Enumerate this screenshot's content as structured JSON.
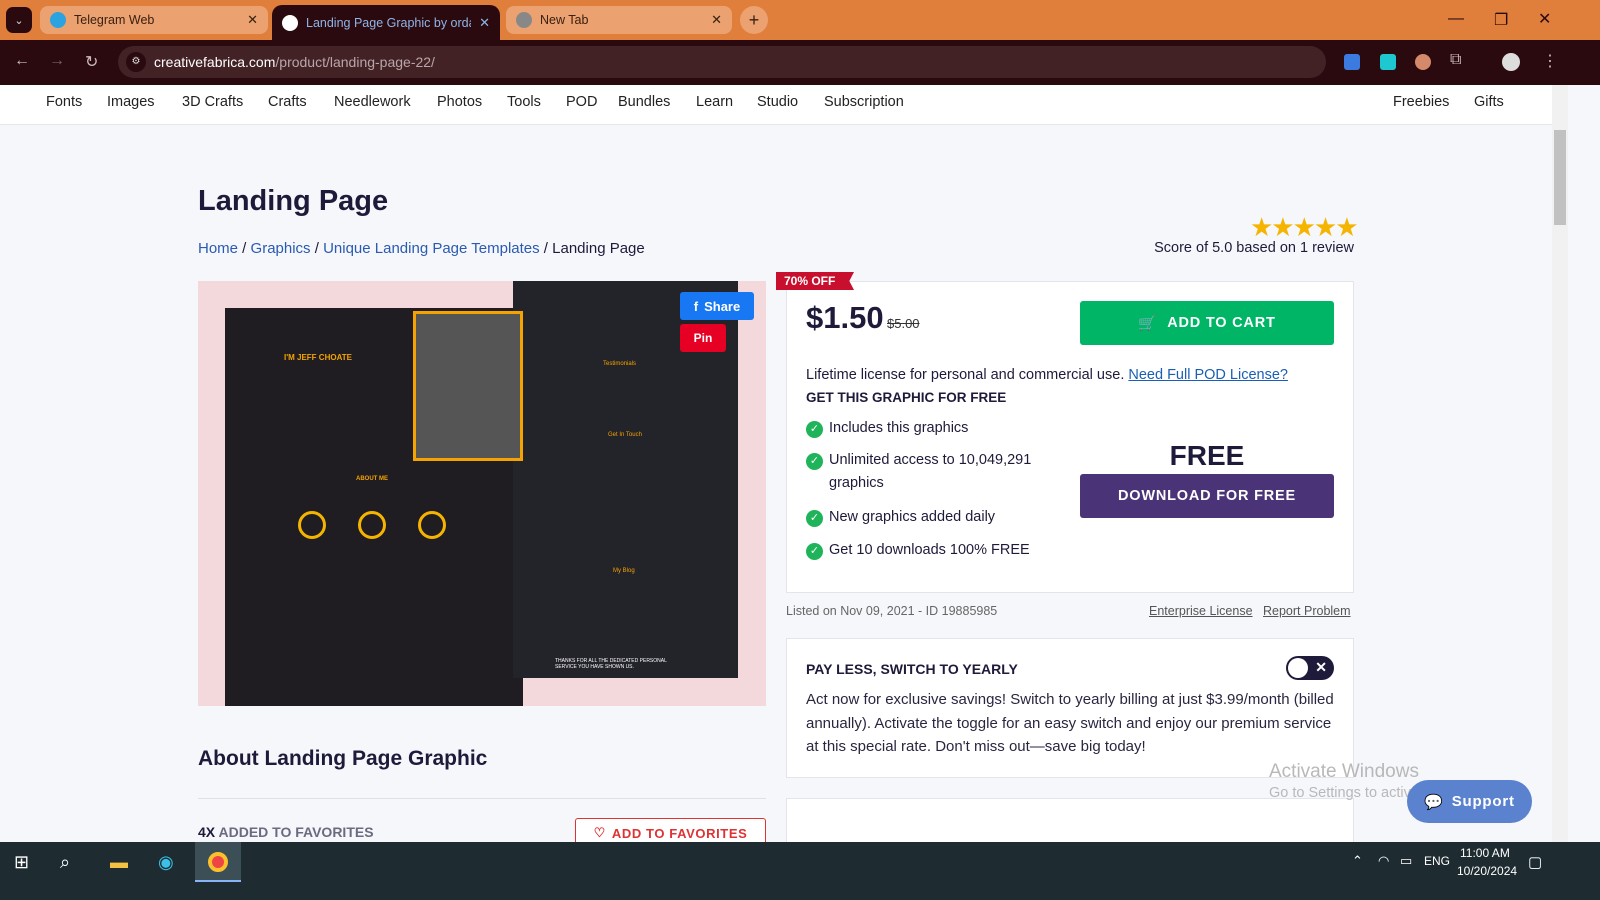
{
  "browser": {
    "tabs": [
      {
        "title": "Telegram Web"
      },
      {
        "title": "Landing Page Graphic by ordair"
      },
      {
        "title": "New Tab"
      }
    ],
    "url_domain": "creativefabrica.com",
    "url_path": "/product/landing-page-22/"
  },
  "nav": {
    "items": [
      "Fonts",
      "Images",
      "3D Crafts",
      "Crafts",
      "Needlework",
      "Photos",
      "Tools",
      "POD",
      "Bundles",
      "Learn",
      "Studio",
      "Subscription"
    ],
    "right": [
      "Freebies",
      "Gifts"
    ]
  },
  "product": {
    "title": "Landing Page",
    "breadcrumbs": [
      "Home",
      "Graphics",
      "Unique Landing Page Templates",
      "Landing Page"
    ],
    "rating_stars": 5,
    "score": "Score of 5.0 based on 1 review",
    "image_texts": {
      "name": "I'M JEFF CHOATE",
      "about": "ABOUT ME",
      "testimonials": "Testimonials",
      "contact": "Get In Touch",
      "blog": "My Blog",
      "thanks": "THANKS FOR ALL THE DEDICATED PERSONAL SERVICE YOU HAVE SHOWN US."
    },
    "share": "Share",
    "pin": "Pin"
  },
  "purchase": {
    "badge": "70% OFF",
    "price": "$1.50",
    "old_price": "$5.00",
    "add_to_cart": "ADD TO CART",
    "license": "Lifetime license for personal and commercial use.",
    "pod_link": "Need Full POD License?",
    "get_free": "GET THIS GRAPHIC FOR FREE",
    "features": [
      "Includes this graphics",
      "Unlimited access to 10,049,291 graphics",
      "New graphics added daily",
      "Get 10 downloads 100% FREE"
    ],
    "free": "FREE",
    "download": "DOWNLOAD FOR FREE"
  },
  "meta": {
    "listed": "Listed on Nov 09, 2021 - ID 19885985",
    "enterprise": "Enterprise License",
    "report": "Report Problem"
  },
  "yearly": {
    "title": "PAY LESS, SWITCH TO YEARLY",
    "text": "Act now for exclusive savings! Switch to yearly billing at just $3.99/month (billed annually). Activate the toggle for an easy switch and enjoy our premium service at this special rate. Don't miss out—save big today!",
    "enabled": false
  },
  "about": {
    "title": "About Landing Page Graphic",
    "fav_count": "4X",
    "fav_label": "ADDED TO FAVORITES",
    "fav_button": "ADD TO FAVORITES"
  },
  "support": "Support",
  "watermark": {
    "line1": "Activate Windows",
    "line2": "Go to Settings to activate Windows."
  },
  "taskbar": {
    "lang": "ENG",
    "time": "11:00 AM",
    "date": "10/20/2024"
  }
}
